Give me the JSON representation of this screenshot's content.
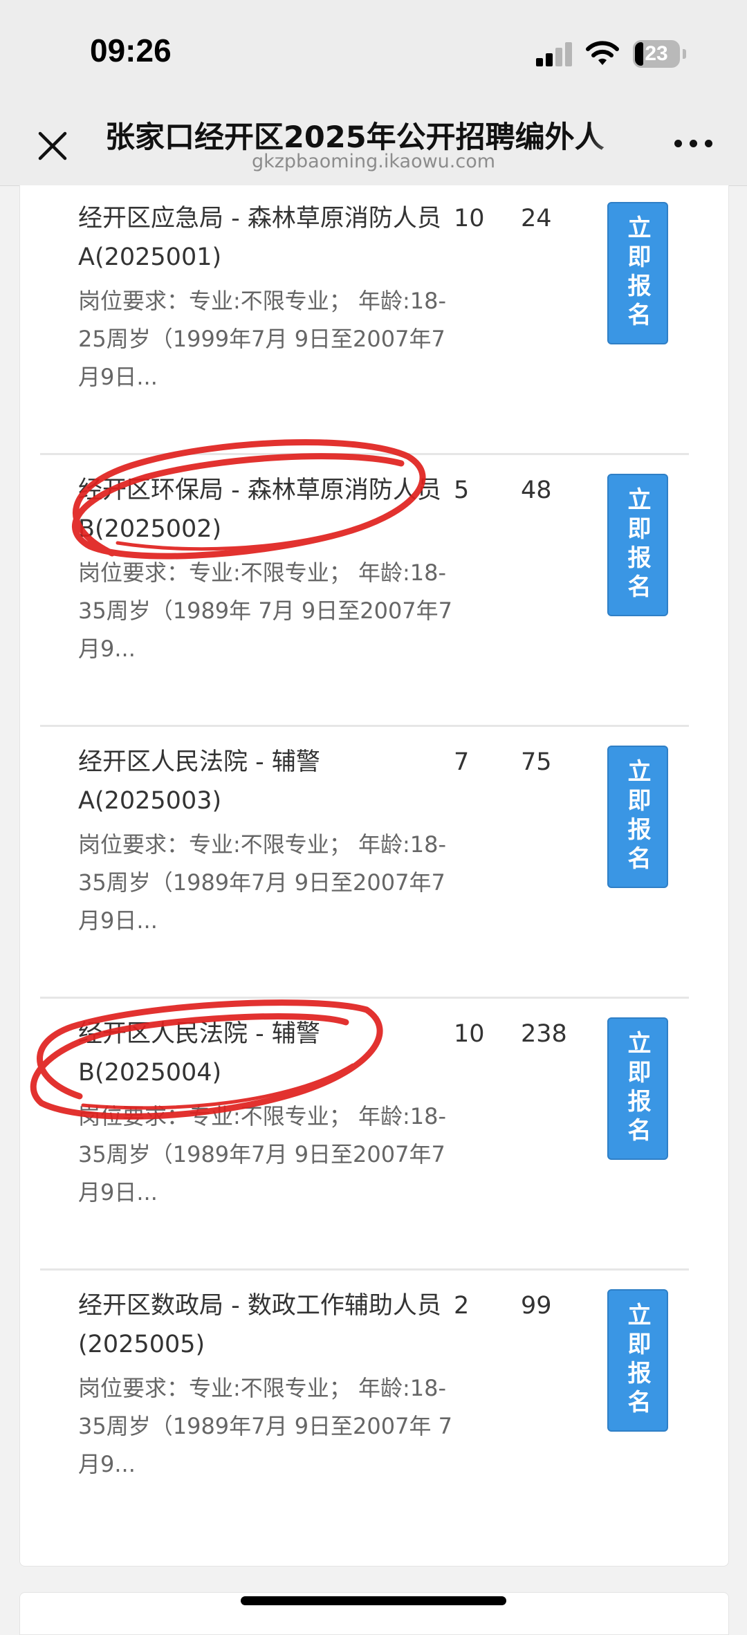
{
  "status_bar": {
    "time": "09:26",
    "battery": "23"
  },
  "nav": {
    "title": "张家口经开区2025年公开招聘编外人",
    "url": "gkzpbaoming.ikaowu.com"
  },
  "jobs": [
    {
      "title": "经开区应急局 - 森林草原消防人员A(2025001)",
      "requirement": "岗位要求：专业:不限专业； 年龄:18-25周岁（1999年7月 9日至2007年7月9日...",
      "plan": "10",
      "applied": "24",
      "apply_label": "立即报名"
    },
    {
      "title": "经开区环保局 - 森林草原消防人员B(2025002)",
      "requirement": "岗位要求：专业:不限专业； 年龄:18-35周岁（1989年 7月 9日至2007年7月9...",
      "plan": "5",
      "applied": "48",
      "apply_label": "立即报名"
    },
    {
      "title": "经开区人民法院 - 辅警A(2025003)",
      "requirement": "岗位要求：专业:不限专业； 年龄:18-35周岁（1989年7月 9日至2007年7月9日...",
      "plan": "7",
      "applied": "75",
      "apply_label": "立即报名"
    },
    {
      "title": "经开区人民法院 - 辅警B(2025004)",
      "requirement": "岗位要求：专业:不限专业； 年龄:18-35周岁（1989年7月 9日至2007年7月9日...",
      "plan": "10",
      "applied": "238",
      "apply_label": "立即报名"
    },
    {
      "title": "经开区数政局 - 数政工作辅助人员(2025005)",
      "requirement": "岗位要求：专业:不限专业； 年龄:18-35周岁（1989年7月 9日至2007年 7月9...",
      "plan": "2",
      "applied": "99",
      "apply_label": "立即报名"
    }
  ],
  "colors": {
    "accent": "#3a96e4",
    "annotation": "#e0211e"
  }
}
